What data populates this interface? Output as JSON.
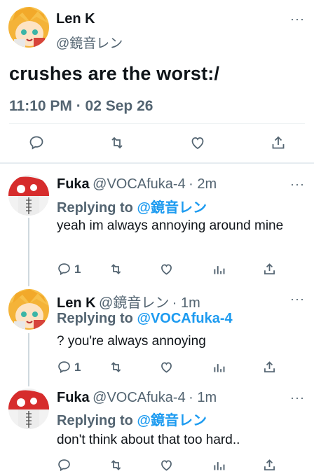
{
  "main_tweet": {
    "author_name": "Len K",
    "author_handle": "@鏡音レン",
    "text": "crushes are the worst:/",
    "timestamp": "11:10 PM · 02 Sep 26"
  },
  "replies": [
    {
      "author_name": "Fuka",
      "author_handle": "@VOCAfuka-4",
      "time": "· 2m",
      "replying_label": "Replying to",
      "replying_to": "@鏡音レン",
      "text": "yeah im always annoying around mine",
      "reply_count": "1"
    },
    {
      "author_name": "Len K",
      "author_handle": "@鏡音レン",
      "time": "· 1m",
      "replying_label": "Replying to",
      "replying_to": "@VOCAfuka-4",
      "text": "? you're always annoying",
      "reply_count": "1"
    },
    {
      "author_name": "Fuka",
      "author_handle": "@VOCAfuka-4",
      "time": "· 1m",
      "replying_label": "Replying to",
      "replying_to": "@鏡音レン",
      "text": "don't think about that too hard..",
      "reply_count": ""
    }
  ],
  "more_glyph": "···",
  "colors": {
    "accent": "#1d9bf0",
    "secondary": "#536471"
  },
  "icons": [
    "more-icon",
    "reply-icon",
    "retweet-icon",
    "like-icon",
    "share-icon",
    "views-icon"
  ]
}
